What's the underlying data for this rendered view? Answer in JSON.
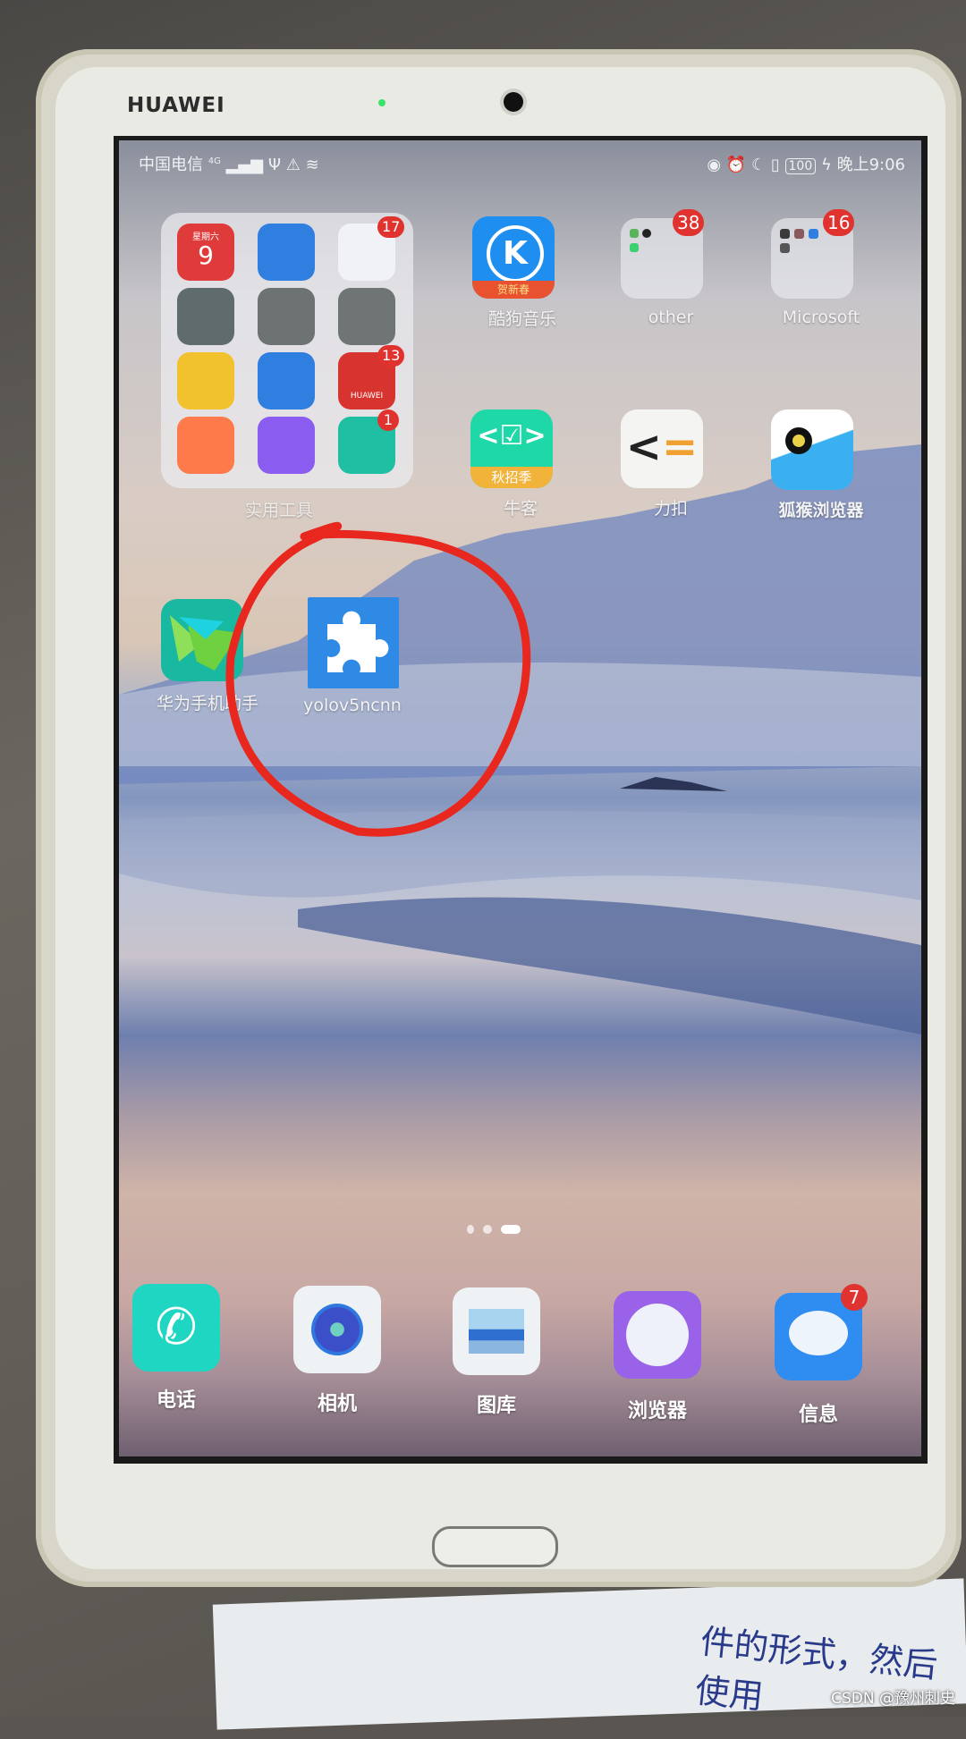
{
  "device": {
    "brand": "HUAWEI"
  },
  "status_bar": {
    "carrier": "中国电信",
    "network": "4G",
    "right_icons": [
      "eye-comfort-icon",
      "alarm-icon",
      "do-not-disturb-icon",
      "vibrate-icon"
    ],
    "battery": "100",
    "time": "晚上9:06"
  },
  "folders": {
    "tools": {
      "label": "实用工具",
      "apps": [
        {
          "name": "calendar",
          "text": "星期六",
          "day": "9",
          "color": "#e03b3b"
        },
        {
          "name": "weather",
          "color": "#2f7fe0"
        },
        {
          "name": "music",
          "badge": "17",
          "color": "#f0f2f5"
        },
        {
          "name": "calculator",
          "color": "#5f6c6b"
        },
        {
          "name": "settings",
          "color": "#6d7373"
        },
        {
          "name": "clock",
          "color": "#6f7574"
        },
        {
          "name": "tips",
          "color": "#f2c12e"
        },
        {
          "name": "phone-manager",
          "color": "#2f7fe0"
        },
        {
          "name": "huawei-appgallery",
          "badge": "13",
          "color": "#d8342f",
          "text": "HUAWEI"
        },
        {
          "name": "themes",
          "color": "#ff7a4a"
        },
        {
          "name": "video-editor",
          "color": "#8a5cf0"
        },
        {
          "name": "member-center",
          "badge": "1",
          "color": "#1fbfa4"
        }
      ]
    },
    "other": {
      "label": "other",
      "badge": "38"
    },
    "microsoft": {
      "label": "Microsoft",
      "badge": "16"
    }
  },
  "apps": [
    {
      "id": "kugou",
      "label": "酷狗音乐",
      "sub": "贺新春",
      "color": "#1e8ef0"
    },
    {
      "id": "nowcoder",
      "label": "牛客",
      "sub": "秋招季",
      "color": "#1ed8a8"
    },
    {
      "id": "leetcode",
      "label": "力扣",
      "color": "#f4f4f2"
    },
    {
      "id": "foxmonkey",
      "label": "狐猴浏览器",
      "color": "#3ab0f0"
    },
    {
      "id": "hisuite",
      "label": "华为手机助手",
      "color": "#19b8a0"
    },
    {
      "id": "yolov5ncnn",
      "label": "yolov5ncnn",
      "color": "#2f8ae6"
    }
  ],
  "page_indicator": {
    "pages": 3,
    "current": 3
  },
  "dock": [
    {
      "id": "phone",
      "label": "电话",
      "color": "#1fd6c2"
    },
    {
      "id": "camera",
      "label": "相机",
      "color": "#eef2f4"
    },
    {
      "id": "gallery",
      "label": "图库",
      "color": "#eef2f4"
    },
    {
      "id": "browser",
      "label": "浏览器",
      "color": "#9a62e8"
    },
    {
      "id": "messages",
      "label": "信息",
      "badge": "7",
      "color": "#2f8cf0"
    }
  ],
  "annotation": {
    "color": "#e8281e",
    "target": "yolov5ncnn"
  },
  "background_text": "件的形式，然后使用",
  "watermark": "CSDN @豫州刺史"
}
